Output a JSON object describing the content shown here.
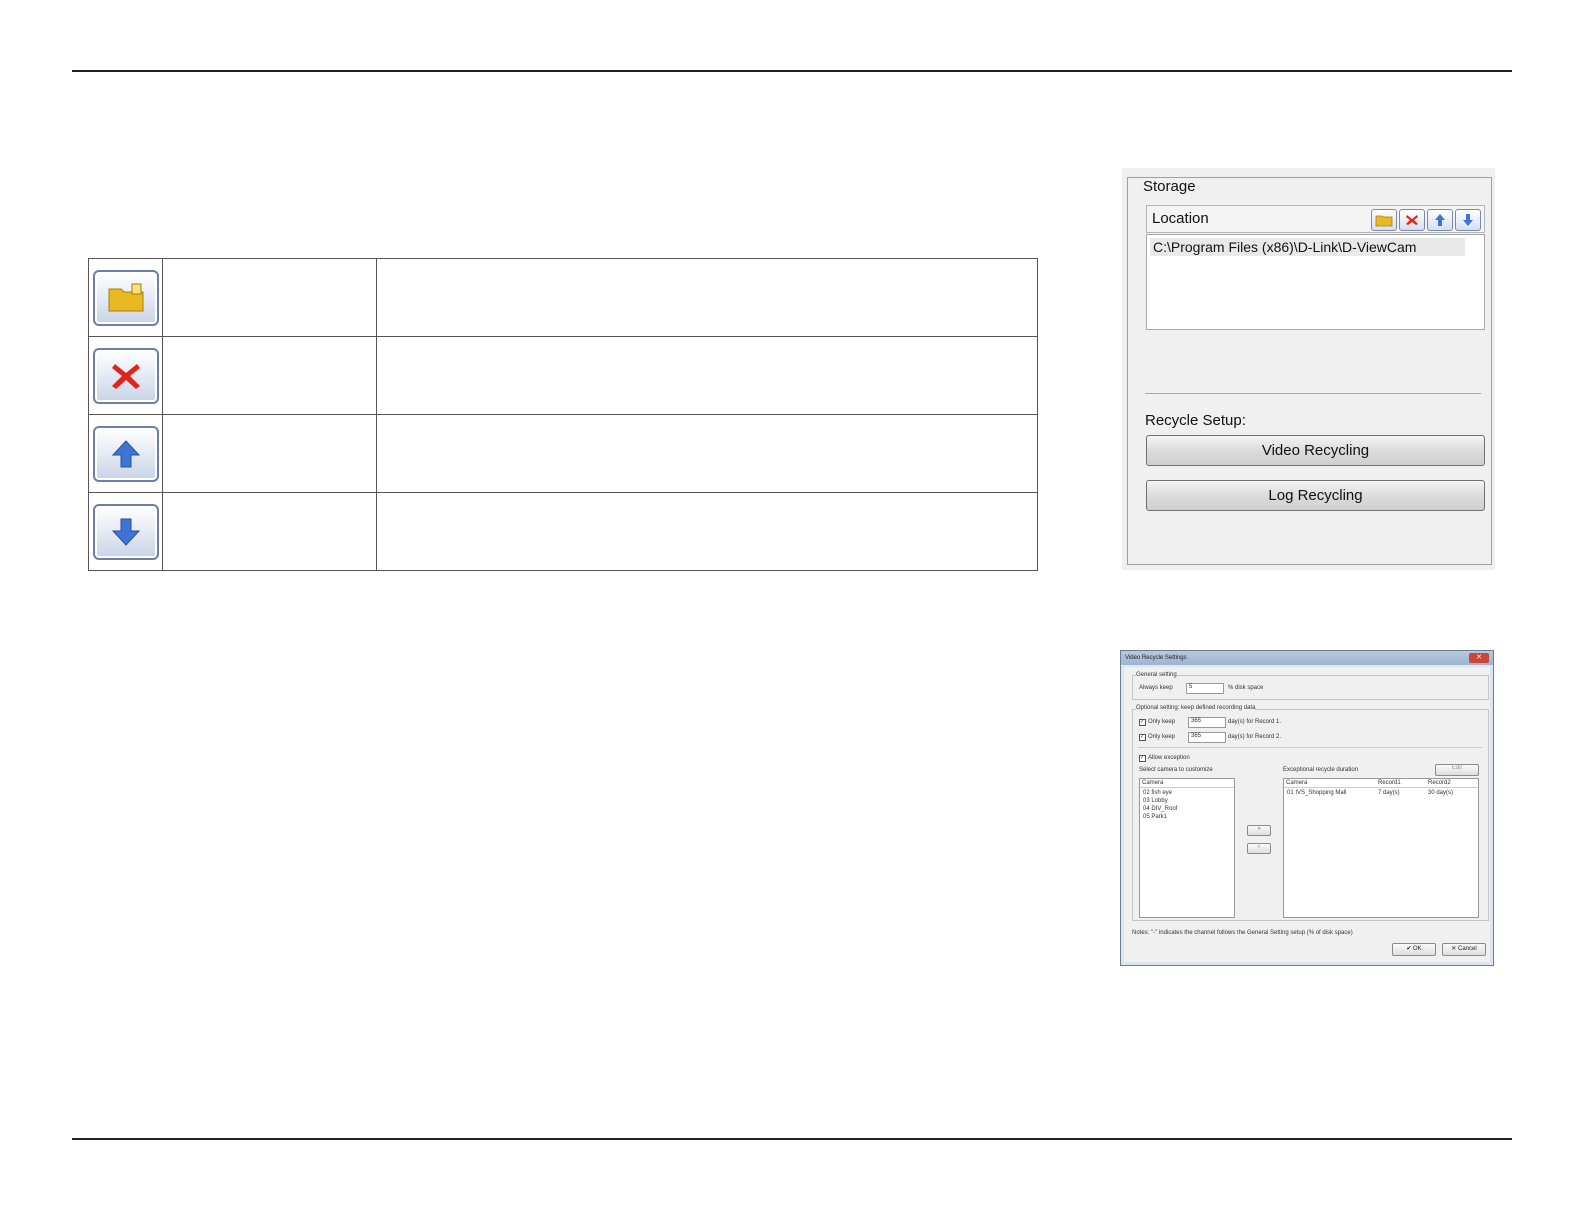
{
  "storage": {
    "legend": "Storage",
    "location_label": "Location",
    "path": "C:\\Program Files (x86)\\D-Link\\D-ViewCam",
    "recycle_label": "Recycle Setup:",
    "video_recycling": "Video Recycling",
    "log_recycling": "Log Recycling",
    "toolbar_icons": [
      "folder-icon",
      "delete-icon",
      "up-arrow-icon",
      "down-arrow-icon"
    ]
  },
  "icon_table": {
    "rows": [
      {
        "icon": "folder-icon",
        "name": "",
        "desc": ""
      },
      {
        "icon": "delete-icon",
        "name": "",
        "desc": ""
      },
      {
        "icon": "up-arrow-icon",
        "name": "",
        "desc": ""
      },
      {
        "icon": "down-arrow-icon",
        "name": "",
        "desc": ""
      }
    ]
  },
  "dialog": {
    "title": "Video Recycle Settings",
    "general_setting": "General setting",
    "always_keep": "Always keep",
    "always_keep_value": "5",
    "disk_space_suffix": "% disk space",
    "optional_setting": "Optional setting: keep defined recording data",
    "only_keep": "Only keep",
    "record1_value": "365",
    "record1_suffix": "day(s) for Record 1.",
    "record2_value": "365",
    "record2_suffix": "day(s) for Record 2.",
    "allow_exception": "Allow exception",
    "select_camera": "Select camera to customize",
    "exceptional": "Exceptional recycle duration",
    "edit": "Edit",
    "camera_header": "Camera",
    "record1_header": "Record1",
    "record2_header": "Record2",
    "left_cameras": [
      "02 fish eye",
      "03 Lobby",
      "04 DIV_Roof",
      "05 Park1"
    ],
    "right_rows": [
      {
        "camera": "01 IVS_Shopping Mall",
        "record1": "7 day(s)",
        "record2": "30 day(s)"
      }
    ],
    "notes": "Notes: \"-\" indicates the channel follows the General Setting setup (% of disk space)",
    "ok": "OK",
    "cancel": "Cancel"
  },
  "colors": {
    "folder": "#e8b923",
    "delete": "#e2231a",
    "arrow": "#3f74d6"
  }
}
